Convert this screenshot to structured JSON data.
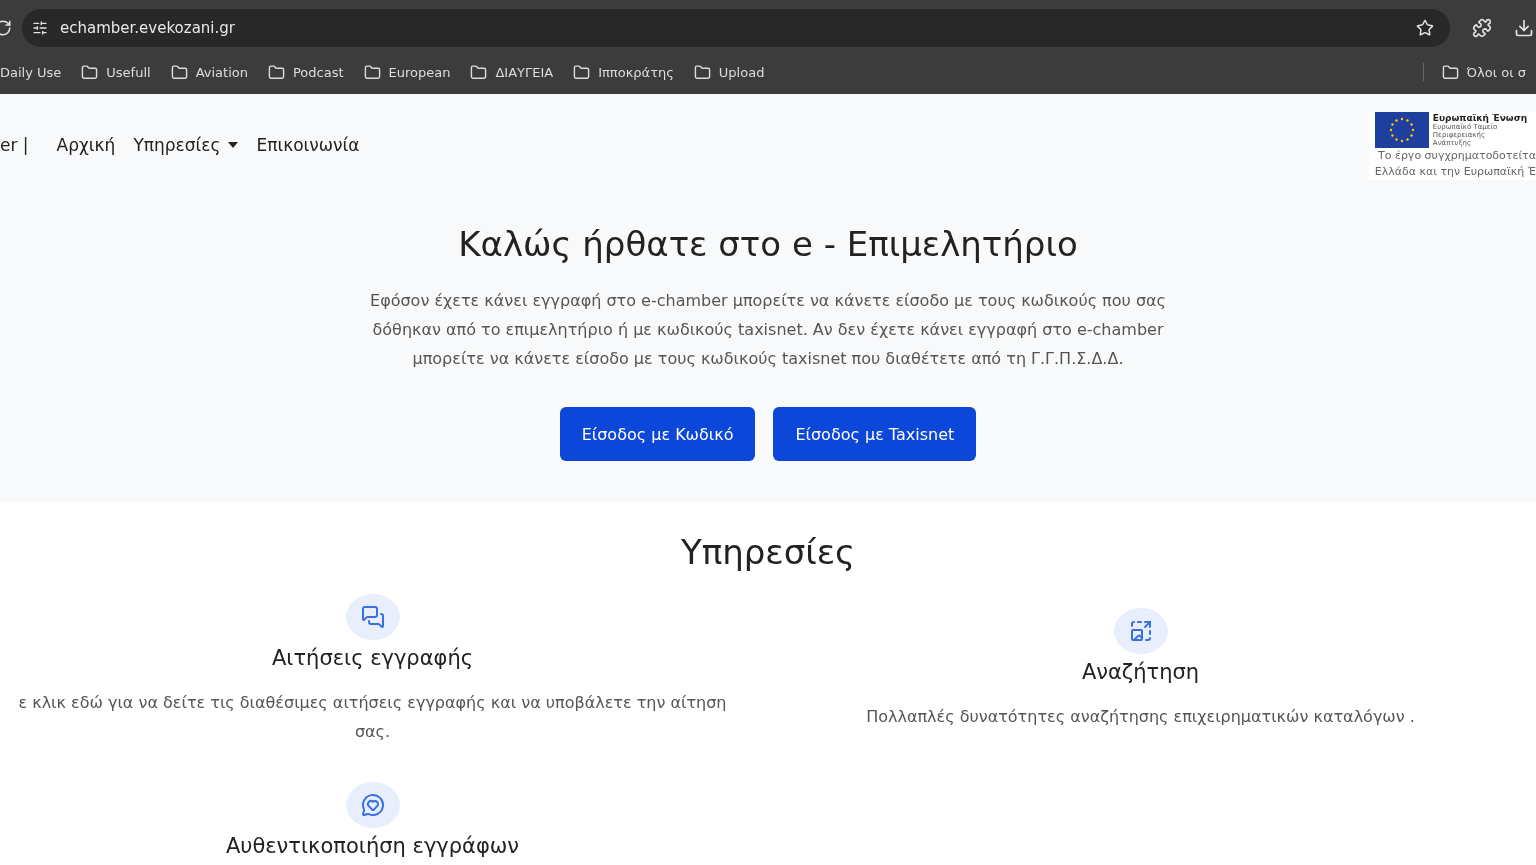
{
  "browser": {
    "url": "echamber.evekozani.gr",
    "first_bookmark": "Daily Use",
    "bookmarks": [
      "Usefull",
      "Aviation",
      "Podcast",
      "European",
      "ΔΙΑΥΓΕΙΑ",
      "Ιπποκράτης",
      "Upload"
    ],
    "other_bookmarks": "Όλοι οι σ"
  },
  "navbar": {
    "brand": "er |",
    "links": [
      {
        "label": "Αρχική",
        "kind": "link"
      },
      {
        "label": "Υπηρεσίες",
        "kind": "dropdown"
      },
      {
        "label": "Επικοινωνία",
        "kind": "link"
      }
    ],
    "eu_logo": {
      "title": "Ευρωπαϊκή Ένωση",
      "subtitle": "Ευρωπαϊκό Ταμείο Περιφερειακής Ανάπτυξης",
      "caption": [
        "Το έργο συγχρηματοδοτείτα",
        "Ελλάδα και την Ευρωπαϊκή Έ"
      ]
    }
  },
  "hero": {
    "title": "Καλώς ήρθατε στο e - Επιμελητήριο",
    "text": "Εφόσον έχετε κάνει εγγραφή στο e-chamber μπορείτε να κάνετε είσοδο με τους κωδικούς που σας δόθηκαν από το επιμελητήριο ή με κωδικούς taxisnet. Αν δεν έχετε κάνει εγγραφή στο e-chamber μπορείτε να κάνετε είσοδο με τους κωδικούς taxisnet που διαθέτετε από τη Γ.Γ.Π.Σ.Δ.Δ.",
    "buttons": [
      "Είσοδος με Κωδικό",
      "Είσοδος με Taxisnet"
    ]
  },
  "services": {
    "title": "Υπηρεσίες",
    "items": [
      {
        "title": "Αιτήσεις εγγραφής",
        "text": "ε κλικ εδώ για να δείτε τις διαθέσιμες αιτήσεις εγγραφής και να υποβάλετε την αίτηση σας."
      },
      {
        "title": "Αναζήτηση",
        "text": "Πολλαπλές δυνατότητες αναζήτησης επιχειρηματικών καταλόγων ."
      },
      {
        "title": "Αυθεντικοποιήση εγγράφων"
      }
    ]
  }
}
